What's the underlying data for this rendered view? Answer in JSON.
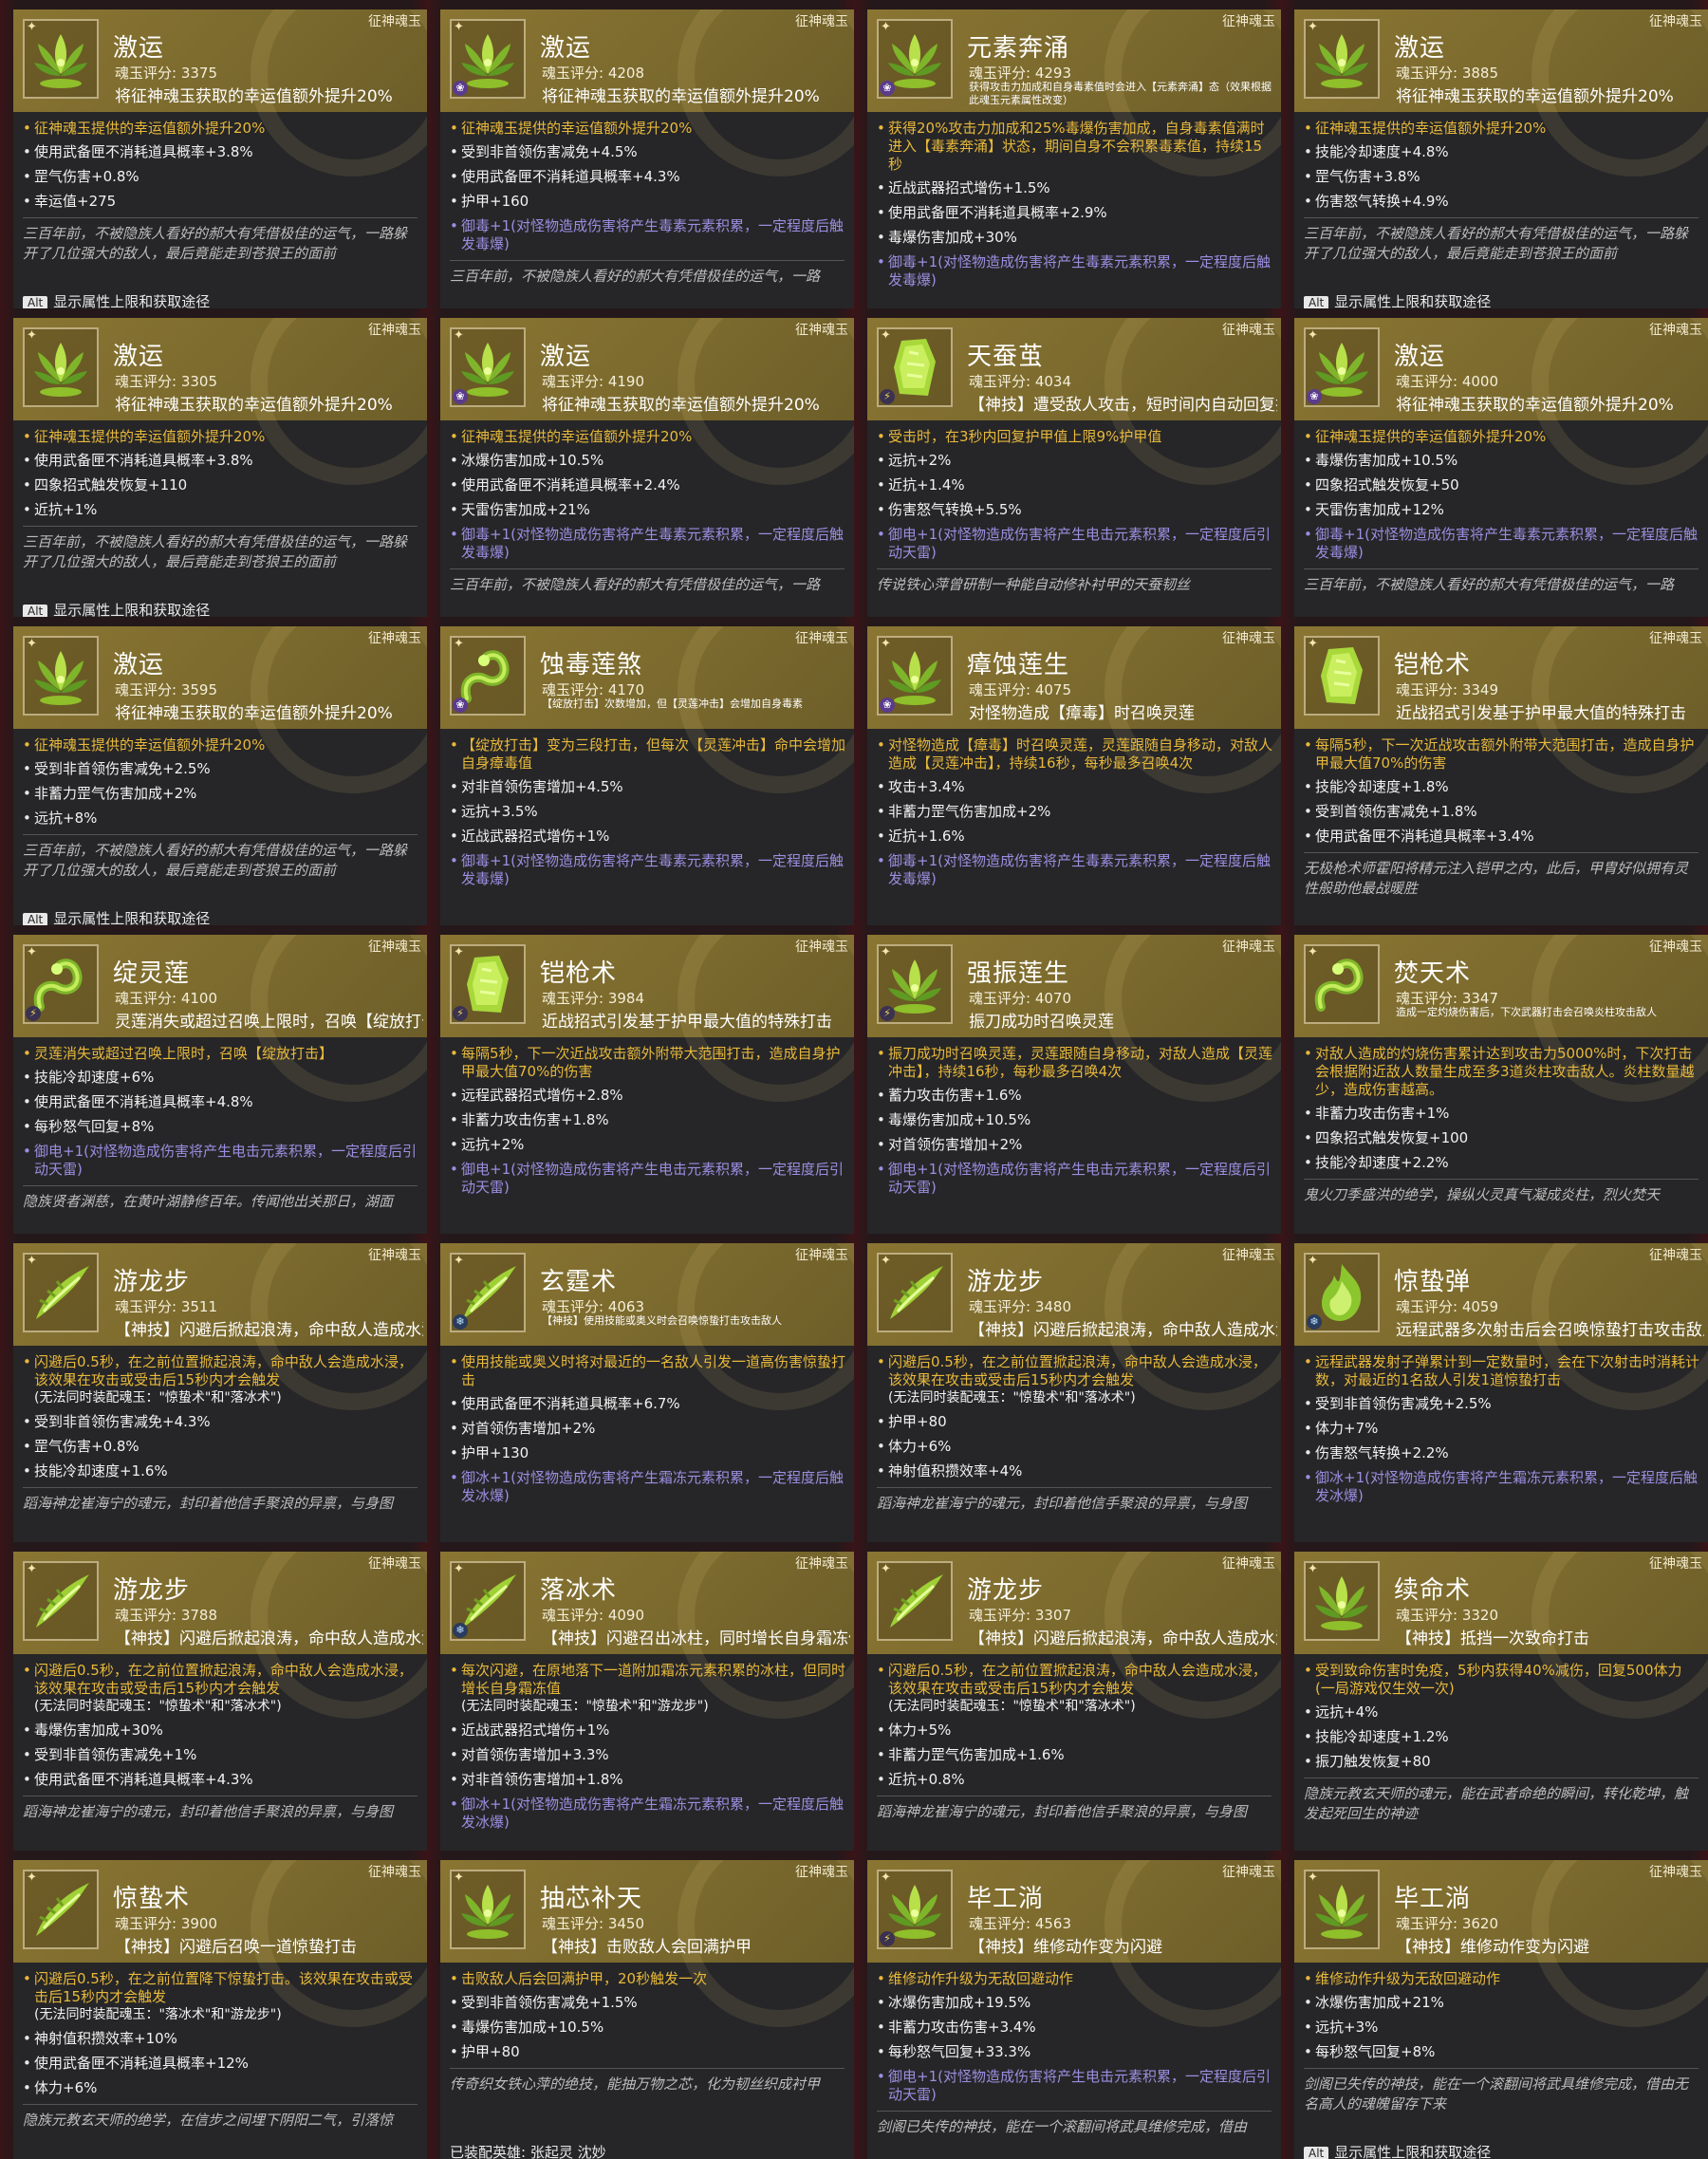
{
  "common": {
    "tag": "征神魂玉",
    "alt_key": "Alt",
    "alt_footer_text": "显示属性上限和获取途径"
  },
  "cards": [
    {
      "name": "激运",
      "score": "魂玉评分: 3375",
      "desc": "将征神魂玉获取的幸运值额外提升20%",
      "icon": "lotus-green-icon",
      "badge": "",
      "effects": [
        {
          "t": "征神魂玉提供的幸运值额外提升20%",
          "k": "gold"
        },
        {
          "t": "使用武备匣不消耗道具概率+3.8%",
          "k": ""
        },
        {
          "t": "罡气伤害+0.8%",
          "k": ""
        },
        {
          "t": "幸运值+275",
          "k": ""
        }
      ],
      "lore": "三百年前，不被隐族人看好的郝大有凭借极佳的运气，一路躲开了几位强大的敌人，最后竟能走到苍狼王的面前",
      "footer": true
    },
    {
      "name": "激运",
      "score": "魂玉评分: 4208",
      "desc": "将征神魂玉获取的幸运值额外提升20%",
      "icon": "lotus-green-icon",
      "badge": "poison",
      "effects": [
        {
          "t": "征神魂玉提供的幸运值额外提升20%",
          "k": "gold"
        },
        {
          "t": "受到非首领伤害减免+4.5%",
          "k": ""
        },
        {
          "t": "使用武备匣不消耗道具概率+4.3%",
          "k": ""
        },
        {
          "t": "护甲+160",
          "k": ""
        },
        {
          "t": "御毒+1(对怪物造成伤害将产生毒素元素积累，一定程度后触发毒爆)",
          "k": "purple"
        }
      ],
      "lore": "三百年前，不被隐族人看好的郝大有凭借极佳的运气，一路",
      "footer": false
    },
    {
      "name": "元素奔涌",
      "score": "魂玉评分: 4293",
      "desc": "获得攻击力加成和自身毒素值时会进入【元素奔涌】态（效果根据此魂玉元素属性改变）",
      "descSmall": true,
      "icon": "lotus-green-icon",
      "badge": "poison",
      "effects": [
        {
          "t": "获得20%攻击力加成和25%毒爆伤害加成，自身毒素值满时进入【毒素奔涌】状态，期间自身不会积累毒素值，持续15秒",
          "k": "gold"
        },
        {
          "t": "近战武器招式增伤+1.5%",
          "k": ""
        },
        {
          "t": "使用武备匣不消耗道具概率+2.9%",
          "k": ""
        },
        {
          "t": "毒爆伤害加成+30%",
          "k": ""
        },
        {
          "t": "御毒+1(对怪物造成伤害将产生毒素元素积累，一定程度后触发毒爆)",
          "k": "purple"
        }
      ],
      "lore": "",
      "footer": false
    },
    {
      "name": "激运",
      "score": "魂玉评分: 3885",
      "desc": "将征神魂玉获取的幸运值额外提升20%",
      "icon": "lotus-green-icon",
      "badge": "",
      "effects": [
        {
          "t": "征神魂玉提供的幸运值额外提升20%",
          "k": "gold"
        },
        {
          "t": "技能冷却速度+4.8%",
          "k": ""
        },
        {
          "t": "罡气伤害+3.8%",
          "k": ""
        },
        {
          "t": "伤害怒气转换+4.9%",
          "k": ""
        }
      ],
      "lore": "三百年前，不被隐族人看好的郝大有凭借极佳的运气，一路躲开了几位强大的敌人，最后竟能走到苍狼王的面前",
      "footer": true
    },
    {
      "name": "激运",
      "score": "魂玉评分: 3305",
      "desc": "将征神魂玉获取的幸运值额外提升20%",
      "icon": "lotus-green-icon",
      "badge": "",
      "effects": [
        {
          "t": "征神魂玉提供的幸运值额外提升20%",
          "k": "gold"
        },
        {
          "t": "使用武备匣不消耗道具概率+3.8%",
          "k": ""
        },
        {
          "t": "四象招式触发恢复+110",
          "k": ""
        },
        {
          "t": "近抗+1%",
          "k": ""
        }
      ],
      "lore": "三百年前，不被隐族人看好的郝大有凭借极佳的运气，一路躲开了几位强大的敌人，最后竟能走到苍狼王的面前",
      "footer": true
    },
    {
      "name": "激运",
      "score": "魂玉评分: 4190",
      "desc": "将征神魂玉获取的幸运值额外提升20%",
      "icon": "lotus-green-icon",
      "badge": "poison",
      "effects": [
        {
          "t": "征神魂玉提供的幸运值额外提升20%",
          "k": "gold"
        },
        {
          "t": "冰爆伤害加成+10.5%",
          "k": ""
        },
        {
          "t": "使用武备匣不消耗道具概率+2.4%",
          "k": ""
        },
        {
          "t": "天雷伤害加成+21%",
          "k": ""
        },
        {
          "t": "御毒+1(对怪物造成伤害将产生毒素元素积累，一定程度后触发毒爆)",
          "k": "purple"
        }
      ],
      "lore": "三百年前，不被隐族人看好的郝大有凭借极佳的运气，一路",
      "footer": false
    },
    {
      "name": "天蚕茧",
      "score": "魂玉评分: 4034",
      "desc": "【神技】遭受敌人攻击，短时间内自动回复护甲值",
      "icon": "cocoon-green-icon",
      "badge": "elec",
      "effects": [
        {
          "t": "受击时，在3秒内回复护甲值上限9%护甲值",
          "k": "gold"
        },
        {
          "t": "远抗+2%",
          "k": ""
        },
        {
          "t": "近抗+1.4%",
          "k": ""
        },
        {
          "t": "伤害怒气转换+5.5%",
          "k": ""
        },
        {
          "t": "御电+1(对怪物造成伤害将产生电击元素积累，一定程度后引动天雷)",
          "k": "purple"
        }
      ],
      "lore": "传说铁心萍曾研制一种能自动修补衬甲的天蚕韧丝",
      "footer": false
    },
    {
      "name": "激运",
      "score": "魂玉评分: 4000",
      "desc": "将征神魂玉获取的幸运值额外提升20%",
      "icon": "lotus-green-icon",
      "badge": "poison",
      "effects": [
        {
          "t": "征神魂玉提供的幸运值额外提升20%",
          "k": "gold"
        },
        {
          "t": "毒爆伤害加成+10.5%",
          "k": ""
        },
        {
          "t": "四象招式触发恢复+50",
          "k": ""
        },
        {
          "t": "天雷伤害加成+12%",
          "k": ""
        },
        {
          "t": "御毒+1(对怪物造成伤害将产生毒素元素积累，一定程度后触发毒爆)",
          "k": "purple"
        }
      ],
      "lore": "三百年前，不被隐族人看好的郝大有凭借极佳的运气，一路",
      "footer": false
    },
    {
      "name": "激运",
      "score": "魂玉评分: 3595",
      "desc": "将征神魂玉获取的幸运值额外提升20%",
      "icon": "lotus-green-icon",
      "badge": "",
      "effects": [
        {
          "t": "征神魂玉提供的幸运值额外提升20%",
          "k": "gold"
        },
        {
          "t": "受到非首领伤害减免+2.5%",
          "k": ""
        },
        {
          "t": "非蓄力罡气伤害加成+2%",
          "k": ""
        },
        {
          "t": "远抗+8%",
          "k": ""
        }
      ],
      "lore": "三百年前，不被隐族人看好的郝大有凭借极佳的运气，一路躲开了几位强大的敌人，最后竟能走到苍狼王的面前",
      "footer": true
    },
    {
      "name": "蚀毒莲煞",
      "score": "魂玉评分: 4170",
      "desc": "【绽放打击】次数增加，但【灵莲冲击】会增加自身毒素",
      "descSmall": true,
      "icon": "serpent-green-icon",
      "badge": "poison",
      "effects": [
        {
          "t": "【绽放打击】变为三段打击，但每次【灵莲冲击】命中会增加自身瘴毒值",
          "k": "gold"
        },
        {
          "t": "对非首领伤害增加+4.5%",
          "k": ""
        },
        {
          "t": "远抗+3.5%",
          "k": ""
        },
        {
          "t": "近战武器招式增伤+1%",
          "k": ""
        },
        {
          "t": "御毒+1(对怪物造成伤害将产生毒素元素积累，一定程度后触发毒爆)",
          "k": "purple"
        }
      ],
      "lore": "",
      "footer": false
    },
    {
      "name": "瘴蚀莲生",
      "score": "魂玉评分: 4075",
      "desc": "对怪物造成【瘴毒】时召唤灵莲",
      "icon": "lotus-green-icon",
      "badge": "poison",
      "effects": [
        {
          "t": "对怪物造成【瘴毒】时召唤灵莲，灵莲跟随自身移动，对敌人造成【灵莲冲击】，持续16秒，每秒最多召唤4次",
          "k": "gold"
        },
        {
          "t": "攻击+3.4%",
          "k": ""
        },
        {
          "t": "非蓄力罡气伤害加成+2%",
          "k": ""
        },
        {
          "t": "近抗+1.6%",
          "k": ""
        },
        {
          "t": "御毒+1(对怪物造成伤害将产生毒素元素积累，一定程度后触发毒爆)",
          "k": "purple"
        }
      ],
      "lore": "",
      "footer": false
    },
    {
      "name": "铠枪术",
      "score": "魂玉评分: 3349",
      "desc": "近战招式引发基于护甲最大值的特殊打击",
      "icon": "cocoon-green-icon",
      "badge": "",
      "effects": [
        {
          "t": "每隔5秒，下一次近战攻击额外附带大范围打击，造成自身护甲最大值70%的伤害",
          "k": "gold"
        },
        {
          "t": "技能冷却速度+1.8%",
          "k": ""
        },
        {
          "t": "受到首领伤害减免+1.8%",
          "k": ""
        },
        {
          "t": "使用武备匣不消耗道具概率+3.4%",
          "k": ""
        }
      ],
      "lore": "无极枪术师霍阳将精元注入铠甲之内，此后，甲胄好似拥有灵性般助他最战暖胜",
      "footer": false
    },
    {
      "name": "绽灵莲",
      "score": "魂玉评分: 4100",
      "desc": "灵莲消失或超过召唤上限时，召唤【绽放打击】",
      "icon": "serpent-green-icon",
      "badge": "elec",
      "effects": [
        {
          "t": "灵莲消失或超过召唤上限时，召唤【绽放打击】",
          "k": "gold"
        },
        {
          "t": "技能冷却速度+6%",
          "k": ""
        },
        {
          "t": "使用武备匣不消耗道具概率+4.8%",
          "k": ""
        },
        {
          "t": "每秒怒气回复+8%",
          "k": ""
        },
        {
          "t": "御电+1(对怪物造成伤害将产生电击元素积累，一定程度后引动天雷)",
          "k": "purple"
        }
      ],
      "lore": "隐族贤者渊慈，在黄叶湖静修百年。传闻他出关那日，湖面",
      "footer": false
    },
    {
      "name": "铠枪术",
      "score": "魂玉评分: 3984",
      "desc": "近战招式引发基于护甲最大值的特殊打击",
      "icon": "cocoon-green-icon",
      "badge": "elec",
      "effects": [
        {
          "t": "每隔5秒，下一次近战攻击额外附带大范围打击，造成自身护甲最大值70%的伤害",
          "k": "gold"
        },
        {
          "t": "远程武器招式增伤+2.8%",
          "k": ""
        },
        {
          "t": "非蓄力攻击伤害+1.8%",
          "k": ""
        },
        {
          "t": "远抗+2%",
          "k": ""
        },
        {
          "t": "御电+1(对怪物造成伤害将产生电击元素积累，一定程度后引动天雷)",
          "k": "purple"
        }
      ],
      "lore": "",
      "footer": false
    },
    {
      "name": "强振莲生",
      "score": "魂玉评分: 4070",
      "desc": "振刀成功时召唤灵莲",
      "icon": "lotus-green-icon",
      "badge": "elec",
      "effects": [
        {
          "t": "振刀成功时召唤灵莲，灵莲跟随自身移动，对敌人造成【灵莲冲击】，持续16秒，每秒最多召唤4次",
          "k": "gold"
        },
        {
          "t": "蓄力攻击伤害+1.6%",
          "k": ""
        },
        {
          "t": "毒爆伤害加成+10.5%",
          "k": ""
        },
        {
          "t": "对首领伤害增加+2%",
          "k": ""
        },
        {
          "t": "御电+1(对怪物造成伤害将产生电击元素积累，一定程度后引动天雷)",
          "k": "purple"
        }
      ],
      "lore": "",
      "footer": false
    },
    {
      "name": "焚天术",
      "score": "魂玉评分: 3347",
      "desc": "造成一定灼烧伤害后，下次武器打击会召唤炎柱攻击敌人",
      "descSmall": true,
      "icon": "serpent-green-icon",
      "badge": "",
      "effects": [
        {
          "t": "对敌人造成的灼烧伤害累计达到攻击力5000%时，下次打击会根据附近敌人数量生成至多3道炎柱攻击敌人。炎柱数量越少，造成伤害越高。",
          "k": "gold"
        },
        {
          "t": "非蓄力攻击伤害+1%",
          "k": ""
        },
        {
          "t": "四象招式触发恢复+100",
          "k": ""
        },
        {
          "t": "技能冷却速度+2.2%",
          "k": ""
        }
      ],
      "lore": "鬼火刀季盛洪的绝学，操纵火灵真气凝成炎柱，烈火焚天",
      "footer": false
    },
    {
      "name": "游龙步",
      "score": "魂玉评分: 3511",
      "desc": "【神技】闪避后掀起浪涛，命中敌人造成水浸",
      "icon": "dragon-green-icon",
      "badge": "",
      "effects": [
        {
          "t": "闪避后0.5秒，在之前位置掀起浪涛，命中敌人会造成水浸，该效果在攻击或受击后15秒内才会触发",
          "sub": "(无法同时装配魂玉：\"惊蛰术\"和\"落冰术\")",
          "k": "gold"
        },
        {
          "t": "受到非首领伤害减免+4.3%",
          "k": ""
        },
        {
          "t": "罡气伤害+0.8%",
          "k": ""
        },
        {
          "t": "技能冷却速度+1.6%",
          "k": ""
        }
      ],
      "lore": "蹈海神龙崔海宁的魂元，封印着他信手聚浪的异禀，与身图",
      "footer": false
    },
    {
      "name": "玄霆术",
      "score": "魂玉评分: 4063",
      "desc": "【神技】使用技能或奥义时会召唤惊蛰打击攻击敌人",
      "descSmall": true,
      "icon": "dragon-green-icon",
      "badge": "ice",
      "effects": [
        {
          "t": "使用技能或奥义时将对最近的一名敌人引发一道高伤害惊蛰打击",
          "k": "gold"
        },
        {
          "t": "使用武备匣不消耗道具概率+6.7%",
          "k": ""
        },
        {
          "t": "对首领伤害增加+2%",
          "k": ""
        },
        {
          "t": "护甲+130",
          "k": ""
        },
        {
          "t": "御冰+1(对怪物造成伤害将产生霜冻元素积累，一定程度后触发冰爆)",
          "k": "purple"
        }
      ],
      "lore": "",
      "footer": false
    },
    {
      "name": "游龙步",
      "score": "魂玉评分: 3480",
      "desc": "【神技】闪避后掀起浪涛，命中敌人造成水浸",
      "icon": "dragon-green-icon",
      "badge": "",
      "effects": [
        {
          "t": "闪避后0.5秒，在之前位置掀起浪涛，命中敌人会造成水浸，该效果在攻击或受击后15秒内才会触发",
          "sub": "(无法同时装配魂玉：\"惊蛰术\"和\"落冰术\")",
          "k": "gold"
        },
        {
          "t": "护甲+80",
          "k": ""
        },
        {
          "t": "体力+6%",
          "k": ""
        },
        {
          "t": "神射值积攒效率+4%",
          "k": ""
        }
      ],
      "lore": "蹈海神龙崔海宁的魂元，封印着他信手聚浪的异禀，与身图",
      "footer": false
    },
    {
      "name": "惊蛰弹",
      "score": "魂玉评分: 4059",
      "desc": "远程武器多次射击后会召唤惊蛰打击攻击敌人",
      "icon": "flame-green-icon",
      "badge": "ice",
      "effects": [
        {
          "t": "远程武器发射子弹累计到一定数量时，会在下次射击时消耗计数，对最近的1名敌人引发1道惊蛰打击",
          "k": "gold"
        },
        {
          "t": "受到非首领伤害减免+2.5%",
          "k": ""
        },
        {
          "t": "体力+7%",
          "k": ""
        },
        {
          "t": "伤害怒气转换+2.2%",
          "k": ""
        },
        {
          "t": "御冰+1(对怪物造成伤害将产生霜冻元素积累，一定程度后触发冰爆)",
          "k": "purple"
        }
      ],
      "lore": "",
      "footer": false
    },
    {
      "name": "游龙步",
      "score": "魂玉评分: 3788",
      "desc": "【神技】闪避后掀起浪涛，命中敌人造成水浸",
      "icon": "dragon-green-icon",
      "badge": "",
      "effects": [
        {
          "t": "闪避后0.5秒，在之前位置掀起浪涛，命中敌人会造成水浸，该效果在攻击或受击后15秒内才会触发",
          "sub": "(无法同时装配魂玉：\"惊蛰术\"和\"落冰术\")",
          "k": "gold"
        },
        {
          "t": "毒爆伤害加成+30%",
          "k": ""
        },
        {
          "t": "受到非首领伤害减免+1%",
          "k": ""
        },
        {
          "t": "使用武备匣不消耗道具概率+4.3%",
          "k": ""
        }
      ],
      "lore": "蹈海神龙崔海宁的魂元，封印着他信手聚浪的异禀，与身图",
      "footer": false
    },
    {
      "name": "落冰术",
      "score": "魂玉评分: 4090",
      "desc": "【神技】闪避召出冰柱，同时增长自身霜冻值",
      "icon": "dragon-green-icon",
      "badge": "ice",
      "effects": [
        {
          "t": "每次闪避，在原地落下一道附加霜冻元素积累的冰柱，但同时增长自身霜冻值",
          "sub": "(无法同时装配魂玉：\"惊蛰术\"和\"游龙步\")",
          "k": "gold"
        },
        {
          "t": "近战武器招式增伤+1%",
          "k": ""
        },
        {
          "t": "对首领伤害增加+3.3%",
          "k": ""
        },
        {
          "t": "对非首领伤害增加+1.8%",
          "k": ""
        },
        {
          "t": "御冰+1(对怪物造成伤害将产生霜冻元素积累，一定程度后触发冰爆)",
          "k": "purple"
        }
      ],
      "lore": "",
      "footer": false
    },
    {
      "name": "游龙步",
      "score": "魂玉评分: 3307",
      "desc": "【神技】闪避后掀起浪涛，命中敌人造成水浸",
      "icon": "dragon-green-icon",
      "badge": "",
      "effects": [
        {
          "t": "闪避后0.5秒，在之前位置掀起浪涛，命中敌人会造成水浸，该效果在攻击或受击后15秒内才会触发",
          "sub": "(无法同时装配魂玉：\"惊蛰术\"和\"落冰术\")",
          "k": "gold"
        },
        {
          "t": "体力+5%",
          "k": ""
        },
        {
          "t": "非蓄力罡气伤害加成+1.6%",
          "k": ""
        },
        {
          "t": "近抗+0.8%",
          "k": ""
        }
      ],
      "lore": "蹈海神龙崔海宁的魂元，封印着他信手聚浪的异禀，与身图",
      "footer": false
    },
    {
      "name": "续命术",
      "score": "魂玉评分: 3320",
      "desc": "【神技】抵挡一次致命打击",
      "icon": "lotus-green-icon",
      "badge": "",
      "effects": [
        {
          "t": "受到致命伤害时免疫，5秒内获得40%减伤，回复500体力(一局游戏仅生效一次)",
          "k": "gold"
        },
        {
          "t": "远抗+4%",
          "k": ""
        },
        {
          "t": "技能冷却速度+1.2%",
          "k": ""
        },
        {
          "t": "振刀触发恢复+80",
          "k": ""
        }
      ],
      "lore": "隐族元教玄天师的魂元，能在武者命绝的瞬间，转化乾坤，触发起死回生的神迹",
      "footer": false
    },
    {
      "name": "惊蛰术",
      "score": "魂玉评分: 3900",
      "desc": "【神技】闪避后召唤一道惊蛰打击",
      "icon": "dragon-green-icon",
      "badge": "",
      "effects": [
        {
          "t": "闪避后0.5秒，在之前位置降下惊蛰打击。该效果在攻击或受击后15秒内才会触发",
          "sub": "(无法同时装配魂玉：\"落冰术\"和\"游龙步\")",
          "k": "gold"
        },
        {
          "t": "神射值积攒效率+10%",
          "k": ""
        },
        {
          "t": "使用武备匣不消耗道具概率+12%",
          "k": ""
        },
        {
          "t": "体力+6%",
          "k": ""
        }
      ],
      "lore": "隐族元教玄天师的绝学，在信步之间埋下阴阳二气，引落惊",
      "footer": false
    },
    {
      "name": "抽芯补天",
      "score": "魂玉评分: 3450",
      "desc": "【神技】击败敌人会回满护甲",
      "icon": "lotus-green-icon",
      "badge": "",
      "effects": [
        {
          "t": "击败敌人后会回满护甲，20秒触发一次",
          "k": "gold"
        },
        {
          "t": "受到非首领伤害减免+1.5%",
          "k": ""
        },
        {
          "t": "毒爆伤害加成+10.5%",
          "k": ""
        },
        {
          "t": "护甲+80",
          "k": ""
        }
      ],
      "lore": "传奇织女铁心萍的绝技，能抽万物之芯，化为韧丝织成衬甲",
      "footer": false,
      "equipped": "已装配英雄: 张起灵 沈妙"
    },
    {
      "name": "毕工淌",
      "score": "魂玉评分: 4563",
      "desc": "【神技】维修动作变为闪避",
      "icon": "lotus-green-icon",
      "badge": "elec",
      "effects": [
        {
          "t": "维修动作升级为无敌回避动作",
          "k": "gold"
        },
        {
          "t": "冰爆伤害加成+19.5%",
          "k": ""
        },
        {
          "t": "非蓄力攻击伤害+3.4%",
          "k": ""
        },
        {
          "t": "每秒怒气回复+33.3%",
          "k": ""
        },
        {
          "t": "御电+1(对怪物造成伤害将产生电击元素积累，一定程度后引动天雷)",
          "k": "purple"
        }
      ],
      "lore": "剑阁已失传的神技，能在一个滚翻间将武具维修完成，借由",
      "footer": false
    },
    {
      "name": "毕工淌",
      "score": "魂玉评分: 3620",
      "desc": "【神技】维修动作变为闪避",
      "icon": "lotus-green-icon",
      "badge": "",
      "effects": [
        {
          "t": "维修动作升级为无敌回避动作",
          "k": "gold"
        },
        {
          "t": "冰爆伤害加成+21%",
          "k": ""
        },
        {
          "t": "远抗+3%",
          "k": ""
        },
        {
          "t": "每秒怒气回复+8%",
          "k": ""
        }
      ],
      "lore": "剑阁已失传的神技，能在一个滚翻间将武具维修完成，借由无名高人的魂魄留存下来",
      "footer": true
    }
  ]
}
